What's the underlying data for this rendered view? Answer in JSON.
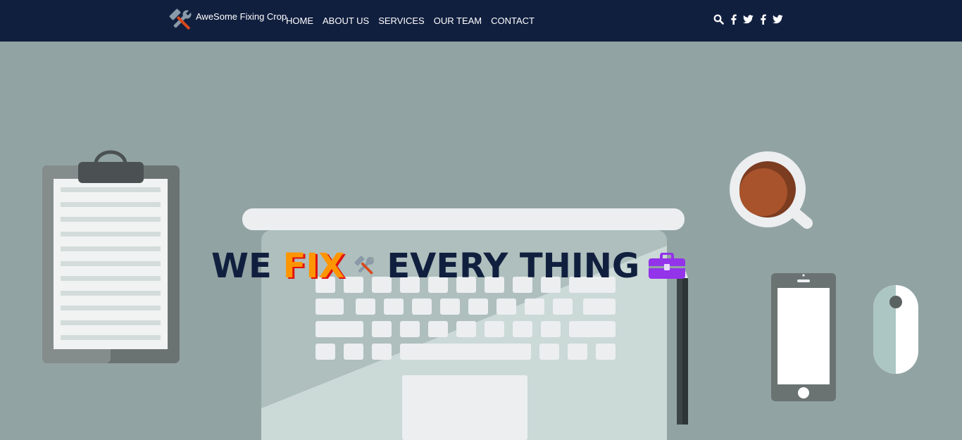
{
  "brand": {
    "name": "AweSome Fixing Crop",
    "logo_icon": "tools-icon"
  },
  "nav": {
    "links": [
      "HOME",
      "ABOUT US",
      "SERVICES",
      "OUR TEAM",
      "CONTACT"
    ]
  },
  "nav_icons": [
    "search-icon",
    "facebook-icon",
    "twitter-icon",
    "facebook-icon",
    "twitter-icon"
  ],
  "hero": {
    "headline_before": "WE",
    "headline_highlight": "FIX",
    "headline_after": "EVERY THING",
    "background_scene": "flat desk illustration with clipboard, laptop, coffee cup, pencil, phone and mouse"
  },
  "colors": {
    "navbar_bg": "#111f3f",
    "hero_bg": "#92a3a3",
    "headline_text": "#111f3f",
    "highlight_text": "#ff9500",
    "highlight_shadow": "#e01010",
    "toolbox_icon": "#9333ea"
  }
}
